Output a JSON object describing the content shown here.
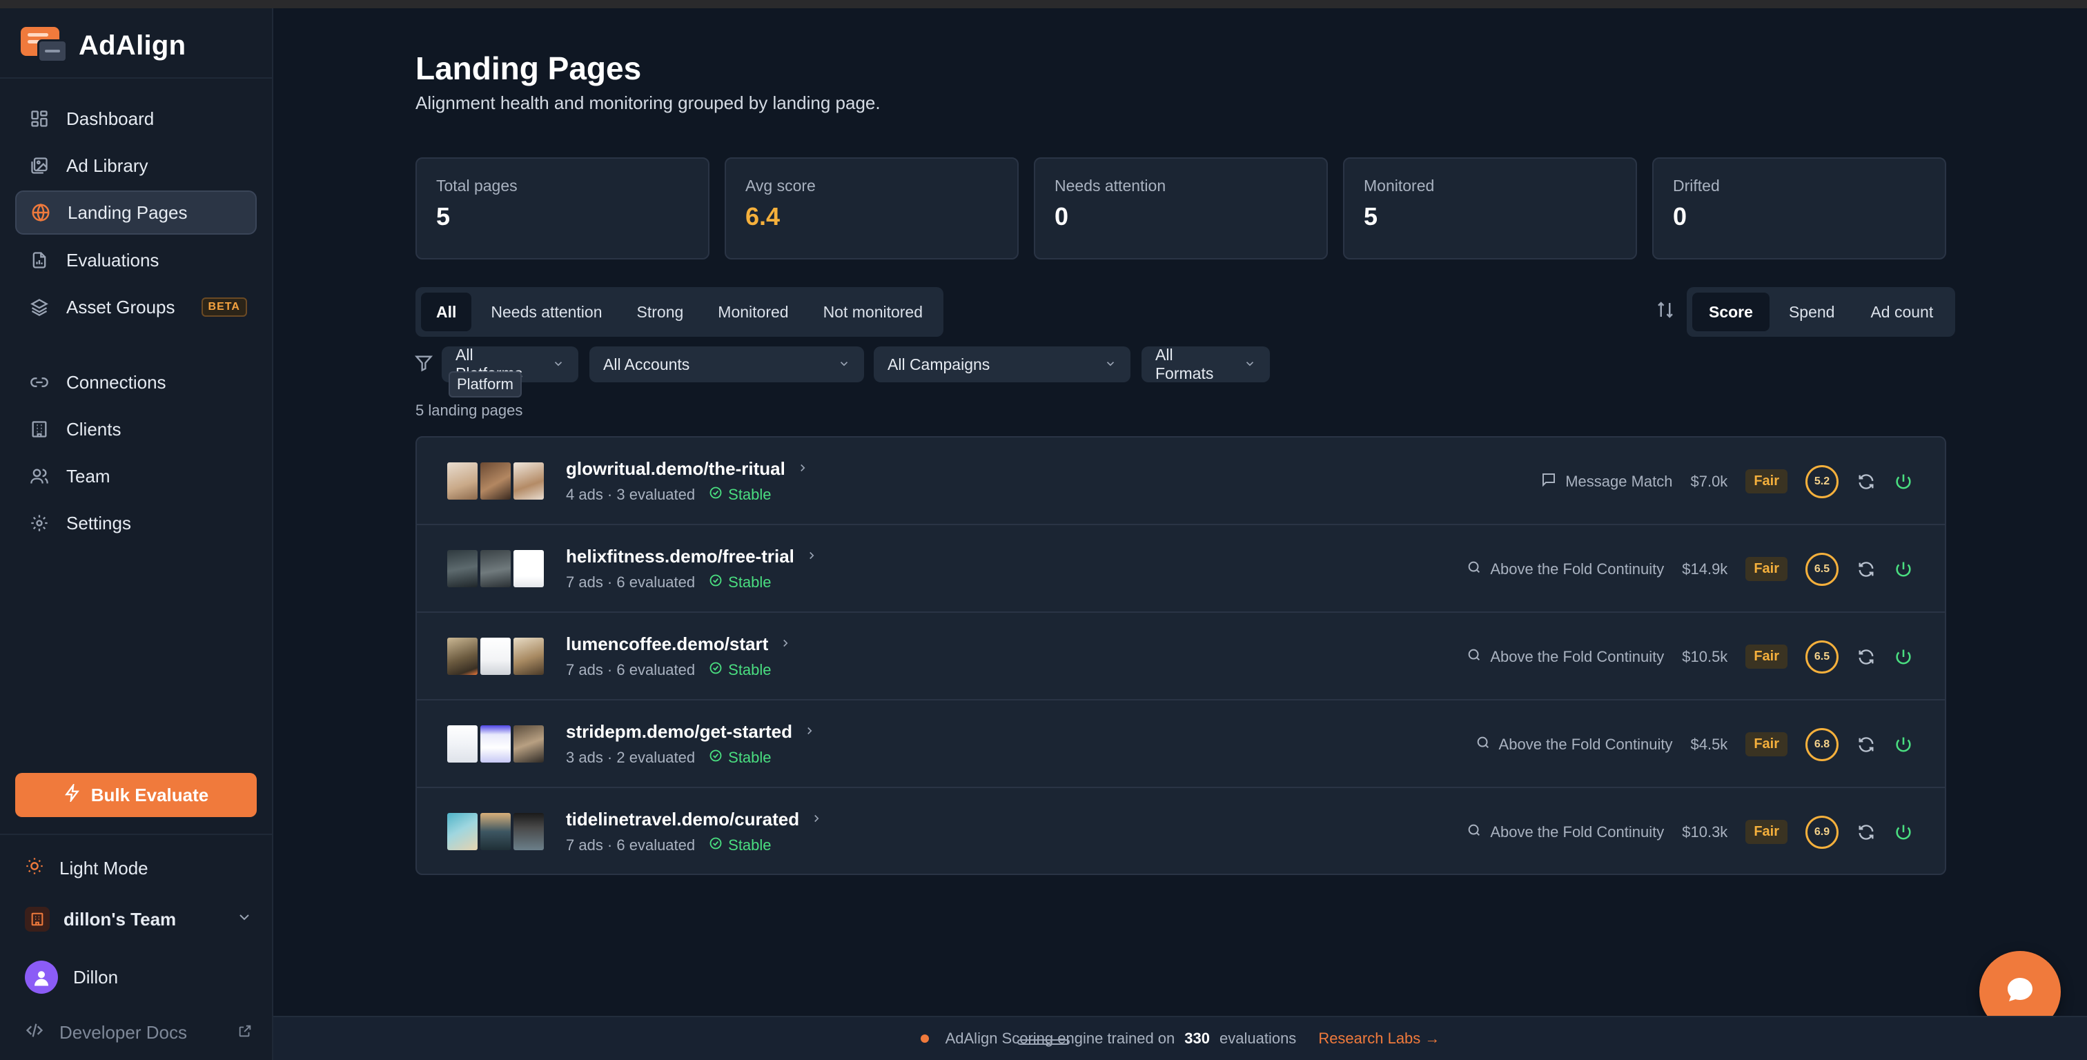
{
  "app": {
    "name": "AdAlign",
    "accent": "#f07a3c"
  },
  "sidebar": {
    "items": [
      {
        "label": "Dashboard",
        "icon": "grid-icon"
      },
      {
        "label": "Ad Library",
        "icon": "image-icon"
      },
      {
        "label": "Landing Pages",
        "icon": "globe-icon",
        "active": true
      },
      {
        "label": "Evaluations",
        "icon": "file-chart-icon"
      },
      {
        "label": "Asset Groups",
        "icon": "layers-icon",
        "badge": "BETA"
      },
      {
        "label": "Connections",
        "icon": "link-icon"
      },
      {
        "label": "Clients",
        "icon": "building-icon"
      },
      {
        "label": "Team",
        "icon": "users-icon"
      },
      {
        "label": "Settings",
        "icon": "gear-icon"
      }
    ],
    "bulk_button": "Bulk Evaluate",
    "light_mode": "Light Mode",
    "team": "dillon's Team",
    "user": "Dillon",
    "dev_docs": "Developer Docs"
  },
  "header": {
    "title": "Landing Pages",
    "subtitle": "Alignment health and monitoring grouped by landing page."
  },
  "stats": [
    {
      "label": "Total pages",
      "value": "5"
    },
    {
      "label": "Avg score",
      "value": "6.4",
      "accent": true
    },
    {
      "label": "Needs attention",
      "value": "0"
    },
    {
      "label": "Monitored",
      "value": "5"
    },
    {
      "label": "Drifted",
      "value": "0"
    }
  ],
  "tabs": [
    "All",
    "Needs attention",
    "Strong",
    "Monitored",
    "Not monitored"
  ],
  "sort_options": [
    "Score",
    "Spend",
    "Ad count"
  ],
  "filters": {
    "platforms": "All Platforms",
    "accounts": "All Accounts",
    "campaigns": "All Campaigns",
    "formats": "All Formats",
    "tooltip": "Platform"
  },
  "count_text": "5 landing pages",
  "rows": [
    {
      "url": "glowritual.demo/the-ritual",
      "meta": "4 ads · 3 evaluated",
      "status": "Stable",
      "issue": "Message Match",
      "issue_icon": "message-icon",
      "spend": "$7.0k",
      "badge": "Fair",
      "score": "5.2"
    },
    {
      "url": "helixfitness.demo/free-trial",
      "meta": "7 ads · 6 evaluated",
      "status": "Stable",
      "issue": "Above the Fold Continuity",
      "issue_icon": "search-icon",
      "spend": "$14.9k",
      "badge": "Fair",
      "score": "6.5"
    },
    {
      "url": "lumencoffee.demo/start",
      "meta": "7 ads · 6 evaluated",
      "status": "Stable",
      "issue": "Above the Fold Continuity",
      "issue_icon": "search-icon",
      "spend": "$10.5k",
      "badge": "Fair",
      "score": "6.5"
    },
    {
      "url": "stridepm.demo/get-started",
      "meta": "3 ads · 2 evaluated",
      "status": "Stable",
      "issue": "Above the Fold Continuity",
      "issue_icon": "search-icon",
      "spend": "$4.5k",
      "badge": "Fair",
      "score": "6.8"
    },
    {
      "url": "tidelinetravel.demo/curated",
      "meta": "7 ads · 6 evaluated",
      "status": "Stable",
      "issue": "Above the Fold Continuity",
      "issue_icon": "search-icon",
      "spend": "$10.3k",
      "badge": "Fair",
      "score": "6.9"
    }
  ],
  "footer": {
    "text_pre": "AdAlign Scoring engine trained on",
    "count": "330",
    "text_post": "evaluations",
    "link": "Research Labs →"
  }
}
